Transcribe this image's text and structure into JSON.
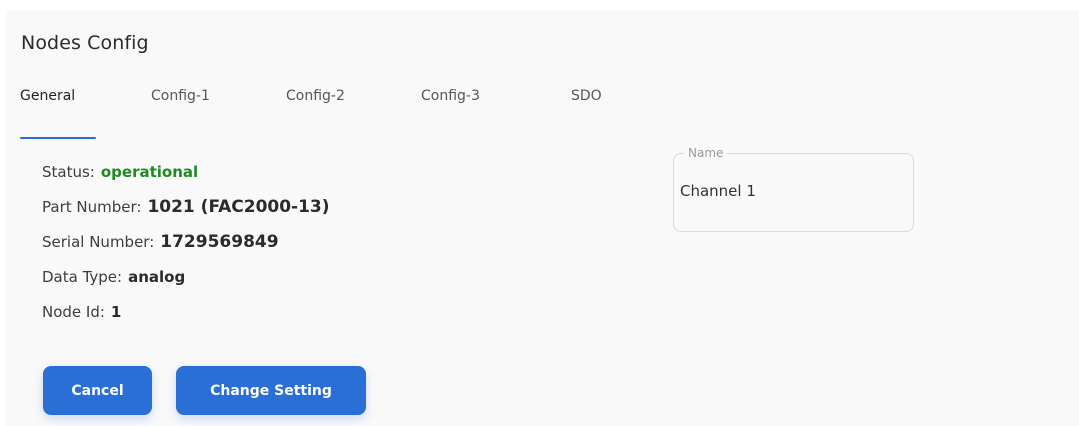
{
  "page": {
    "title": "Nodes Config"
  },
  "tabs": [
    {
      "label": "General",
      "active": true
    },
    {
      "label": "Config-1"
    },
    {
      "label": "Config-2"
    },
    {
      "label": "Config-3"
    },
    {
      "label": "SDO"
    }
  ],
  "info": {
    "status_label": "Status:",
    "status_value": "operational",
    "part_number_label": "Part Number:",
    "part_number_value": "1021 (FAC2000-13)",
    "serial_number_label": "Serial Number:",
    "serial_number_value": "1729569849",
    "data_type_label": "Data Type:",
    "data_type_value": "analog",
    "node_id_label": "Node Id:",
    "node_id_value": "1"
  },
  "buttons": {
    "cancel": "Cancel",
    "change_setting": "Change Setting"
  },
  "name_field": {
    "label": "Name",
    "value": "Channel 1"
  },
  "colors": {
    "accent": "#2a6fd6",
    "status_ok": "#1f8a1f",
    "panel_bg": "#f9f9f9"
  }
}
